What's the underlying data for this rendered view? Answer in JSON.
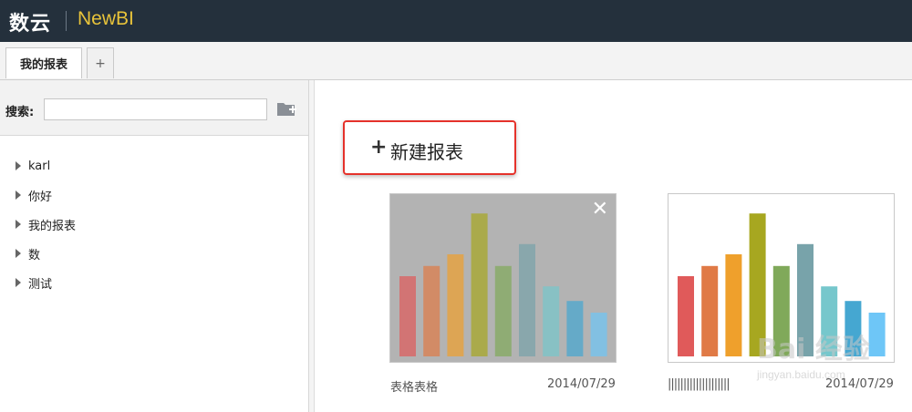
{
  "app": {
    "logo_cn": "数云",
    "logo_en": "NewBI"
  },
  "tabs": [
    {
      "label": "我的报表"
    },
    {
      "label": "+"
    }
  ],
  "sidebar": {
    "search_label": "搜索:",
    "search_value": "",
    "search_placeholder": "",
    "add_folder_icon": "folder-plus-icon",
    "items": [
      {
        "label": "karl"
      },
      {
        "label": "你好"
      },
      {
        "label": "我的报表"
      },
      {
        "label": "数"
      },
      {
        "label": "测试"
      }
    ]
  },
  "main": {
    "new_report_plus": "+",
    "new_report_label": "新建报表",
    "reports": [
      {
        "name": "表格表格",
        "date": "2014/07/29",
        "state": "hover",
        "close_glyph": "✕"
      },
      {
        "name": "||||||||||||||||||||",
        "date": "2014/07/29",
        "state": "normal"
      }
    ],
    "thumbnail_bars": {
      "values": [
        0.55,
        0.62,
        0.7,
        0.98,
        0.62,
        0.77,
        0.48,
        0.38,
        0.3
      ],
      "colors": [
        "#e05a5a",
        "#e07a46",
        "#efa02c",
        "#a7a720",
        "#80a95a",
        "#78a3aa",
        "#76c7cc",
        "#45a7d1",
        "#6ec6f7"
      ]
    }
  },
  "watermark": {
    "text": "Bai 经验",
    "url": "jingyan.baidu.com"
  }
}
